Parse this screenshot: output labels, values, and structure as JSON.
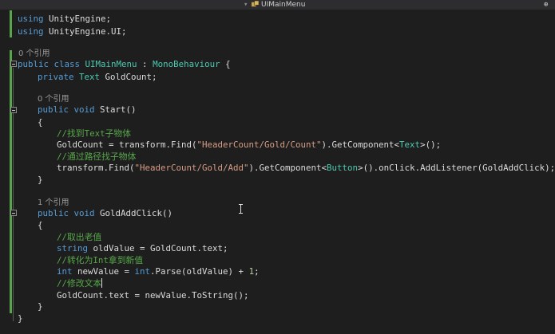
{
  "tab": {
    "title": "UIMainMenu"
  },
  "colors": {
    "background": "#1e1e1e",
    "keyword": "#569cd6",
    "type": "#4ec9b0",
    "string": "#d69d85",
    "comment": "#57a64a",
    "number": "#b5cea8",
    "plain": "#dcdcdc",
    "codelens": "#999999"
  },
  "editor": {
    "usings": [
      {
        "kw": "using",
        "ns": "UnityEngine;"
      },
      {
        "kw": "using",
        "ns": "UnityEngine.UI;"
      }
    ],
    "codelens": {
      "class_refs": "0 个引用",
      "start_refs": "0 个引用",
      "click_refs": "1 个引用"
    },
    "class_decl": {
      "mod": "public class",
      "name": "UIMainMenu",
      "sep": " : ",
      "base": "MonoBehaviour",
      "brace": " {"
    },
    "field": {
      "mod": "private",
      "type": "Text",
      "name": " GoldCount;"
    },
    "start": {
      "sig_kw": "public void",
      "sig_rest": " Start()",
      "comment1": "//找到Text子物体",
      "l1_a": "GoldCount = transform.Find(",
      "l1_str": "\"HeaderCount/Gold/Count\"",
      "l1_b": ").GetComponent<",
      "l1_type": "Text",
      "l1_c": ">();",
      "comment2": "//通过路径找子物体",
      "l2_a": "transform.Find(",
      "l2_str": "\"HeaderCount/Gold/Add\"",
      "l2_b": ").GetComponent<",
      "l2_type": "Button",
      "l2_c": ">().onClick.AddListener(GoldAddClick);"
    },
    "click": {
      "sig_kw": "public void",
      "sig_rest": " GoldAddClick()",
      "comment1": "//取出老值",
      "l1_kw": "string",
      "l1_rest": " oldValue = GoldCount.text;",
      "comment2": "//转化为Int拿到新值",
      "l2_kw": "int",
      "l2_a": " newValue = ",
      "l2_kw2": "int",
      "l2_b": ".Parse(oldValue) + ",
      "l2_num": "1",
      "l2_c": ";",
      "comment3": "//修改文本",
      "l3": "GoldCount.text = newValue.ToString();"
    },
    "braces": {
      "open": "{",
      "close": "}"
    }
  }
}
